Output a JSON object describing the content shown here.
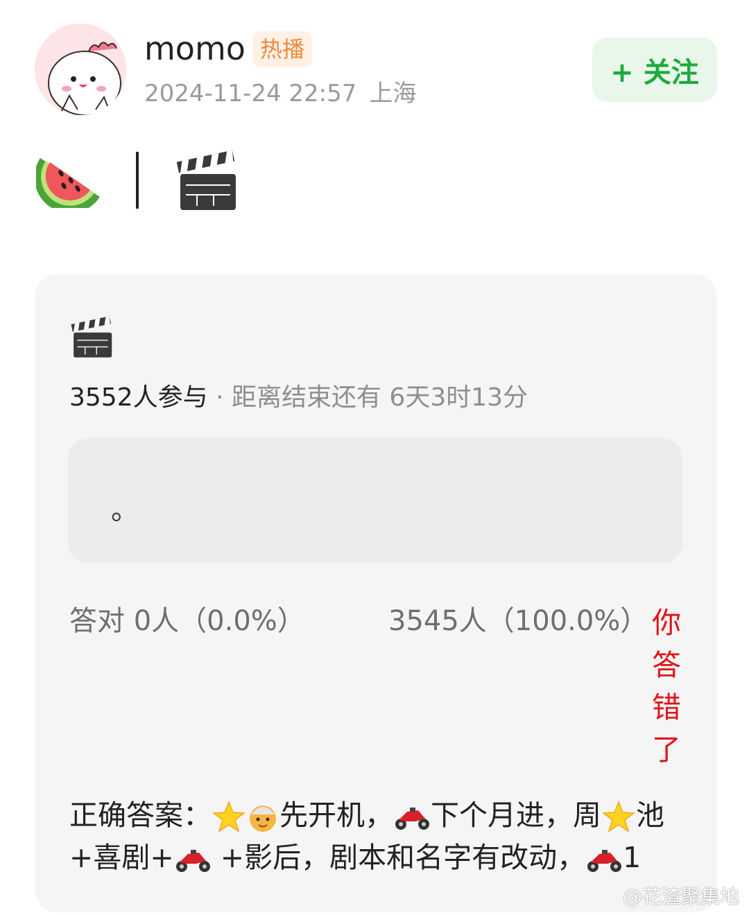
{
  "user": {
    "name": "momo",
    "badge": "热播",
    "time": "2024-11-24 22:57",
    "location": "上海",
    "avatar": "pink-cartoon-avatar"
  },
  "follow_button": {
    "label": "+ 关注"
  },
  "post": {
    "icons": [
      "watermelon-icon",
      "vertical-bar",
      "clapperboard-icon"
    ]
  },
  "quiz": {
    "icon": "clapperboard-icon",
    "participants": "3552人参与",
    "separator": "·",
    "countdown": "距离结束还有 6天3时13分",
    "answer_box_text": "。",
    "result_left": "答对  0人（0.0%）",
    "result_right": "3545人（100.0%）",
    "wrong_label": "你答错了",
    "correct_answer": {
      "prefix": "正确答案：",
      "part1": "先开机，",
      "part2": "下个月进，周",
      "part3": "池+喜剧+",
      "part4": " +影后，剧本和名字有改动，",
      "part5": "1"
    }
  },
  "watermark": "@花渣聚集地",
  "colors": {
    "follow_green": "#1ea93c",
    "badge_orange": "#f08a3c",
    "wrong_red": "#e0151a"
  }
}
